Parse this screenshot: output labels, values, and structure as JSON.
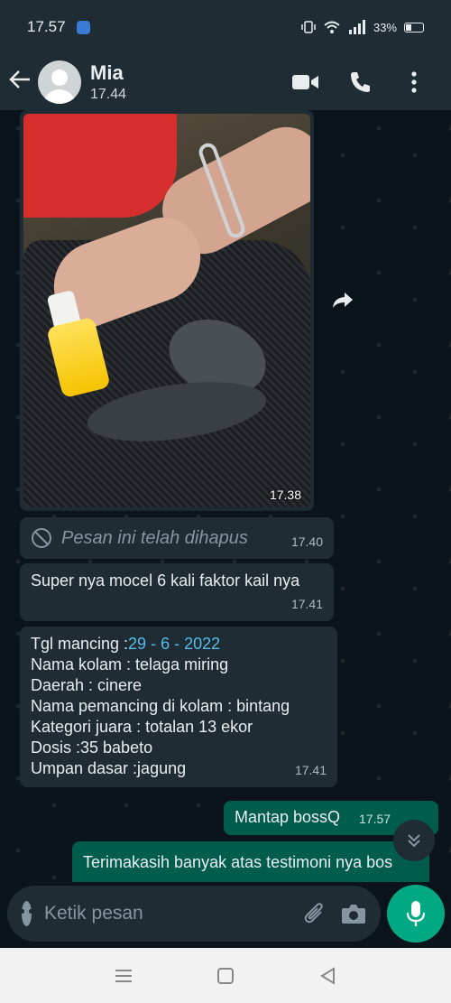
{
  "status_bar": {
    "time": "17.57",
    "battery": "33%",
    "battery_level": 0.33
  },
  "header": {
    "contact_name": "Mia",
    "last_seen": "17.44"
  },
  "messages": {
    "photo": {
      "time": "17.38"
    },
    "deleted": {
      "text": "Pesan ini telah dihapus",
      "time": "17.40"
    },
    "incoming_1": {
      "text": "Super nya mocel 6 kali faktor kail nya",
      "time": "17.41"
    },
    "incoming_2": {
      "line1_label": "Tgl mancing :",
      "line1_date": "29 - 6 - 2022",
      "line2": "Nama kolam : telaga miring",
      "line3": "Daerah : cinere",
      "line4": "Nama pemancing di kolam :  bintang",
      "line5": "Kategori juara : totalan 13 ekor",
      "line6": "Dosis :35 babeto",
      "line7": "Umpan dasar :jagung",
      "time": "17.41"
    },
    "outgoing_1": {
      "text": "Mantap bossQ",
      "time": "17.57"
    },
    "outgoing_2": {
      "text": "Terimakasih banyak atas testimoni nya bos"
    }
  },
  "composer": {
    "placeholder": "Ketik pesan"
  },
  "colors": {
    "header_bg": "#1f2c34",
    "chat_bg": "#0b141a",
    "outgoing_bubble": "#005c4b",
    "accent": "#00a884",
    "link": "#53bdeb"
  }
}
